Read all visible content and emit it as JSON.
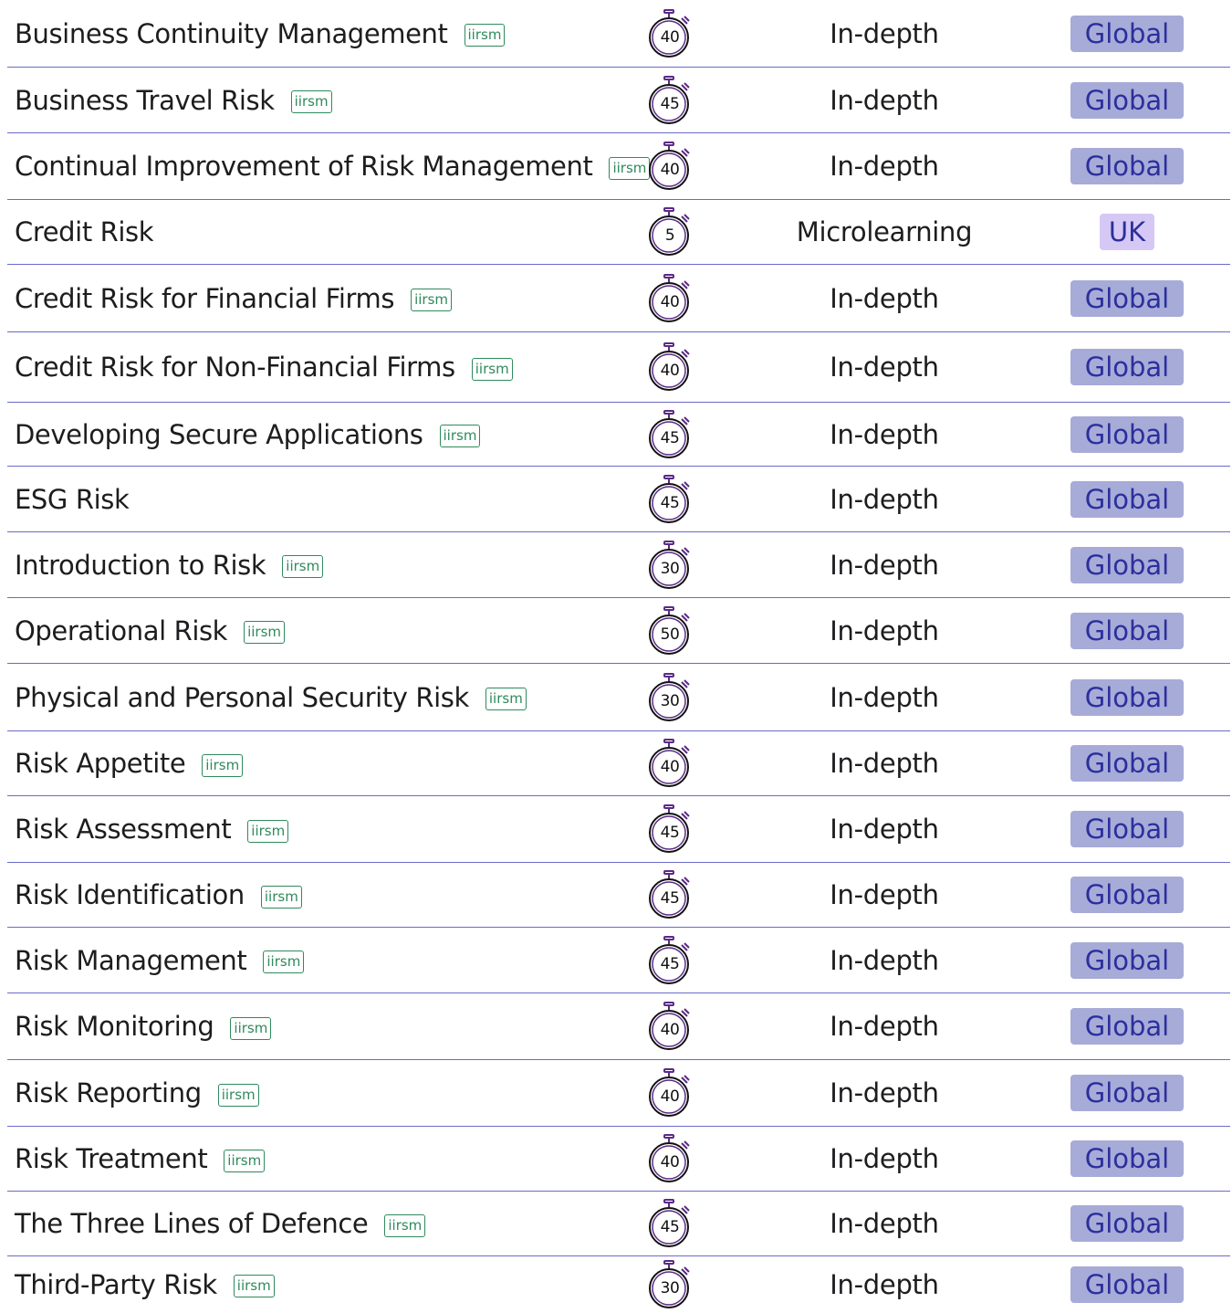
{
  "colors": {
    "divider": "#6b6bc9",
    "iirsm_badge": "#2f8a5c",
    "stopwatch": "#5b2a86",
    "global_pill_bg": "#a7abd8",
    "uk_pill_bg": "#d6c8f4",
    "pill_text": "#2b2f9c"
  },
  "icons": {
    "duration": "stopwatch-icon",
    "accreditation": "iirsm-badge"
  },
  "courses": [
    {
      "title": "Business Continuity Management",
      "badge": "iirsm",
      "duration": "40",
      "type": "In-depth",
      "region": "Global"
    },
    {
      "title": "Business Travel Risk",
      "badge": "iirsm",
      "duration": "45",
      "type": "In-depth",
      "region": "Global"
    },
    {
      "title": "Continual Improvement of Risk Management",
      "badge": "iirsm",
      "duration": "40",
      "type": "In-depth",
      "region": "Global"
    },
    {
      "title": "Credit Risk",
      "badge": "",
      "duration": "5",
      "type": "Microlearning",
      "region": "UK"
    },
    {
      "title": "Credit Risk for Financial Firms",
      "badge": "iirsm",
      "duration": "40",
      "type": "In-depth",
      "region": "Global"
    },
    {
      "title": "Credit Risk for Non-Financial Firms",
      "badge": "iirsm",
      "duration": "40",
      "type": "In-depth",
      "region": "Global"
    },
    {
      "title": "Developing Secure Applications",
      "badge": "iirsm",
      "duration": "45",
      "type": "In-depth",
      "region": "Global"
    },
    {
      "title": "ESG Risk",
      "badge": "",
      "duration": "45",
      "type": "In-depth",
      "region": "Global"
    },
    {
      "title": "Introduction to Risk",
      "badge": "iirsm",
      "duration": "30",
      "type": "In-depth",
      "region": "Global"
    },
    {
      "title": "Operational Risk",
      "badge": "iirsm",
      "duration": "50",
      "type": "In-depth",
      "region": "Global"
    },
    {
      "title": "Physical and Personal Security Risk",
      "badge": "iirsm",
      "duration": "30",
      "type": "In-depth",
      "region": "Global"
    },
    {
      "title": "Risk Appetite",
      "badge": "iirsm",
      "duration": "40",
      "type": "In-depth",
      "region": "Global"
    },
    {
      "title": "Risk Assessment",
      "badge": "iirsm",
      "duration": "45",
      "type": "In-depth",
      "region": "Global"
    },
    {
      "title": "Risk Identification",
      "badge": "iirsm",
      "duration": "45",
      "type": "In-depth",
      "region": "Global"
    },
    {
      "title": "Risk Management",
      "badge": "iirsm",
      "duration": "45",
      "type": "In-depth",
      "region": "Global"
    },
    {
      "title": "Risk Monitoring",
      "badge": "iirsm",
      "duration": "40",
      "type": "In-depth",
      "region": "Global"
    },
    {
      "title": "Risk Reporting",
      "badge": "iirsm",
      "duration": "40",
      "type": "In-depth",
      "region": "Global"
    },
    {
      "title": "Risk Treatment",
      "badge": "iirsm",
      "duration": "40",
      "type": "In-depth",
      "region": "Global"
    },
    {
      "title": "The Three Lines of Defence",
      "badge": "iirsm",
      "duration": "45",
      "type": "In-depth",
      "region": "Global"
    },
    {
      "title": "Third-Party Risk",
      "badge": "iirsm",
      "duration": "30",
      "type": "In-depth",
      "region": "Global"
    }
  ]
}
